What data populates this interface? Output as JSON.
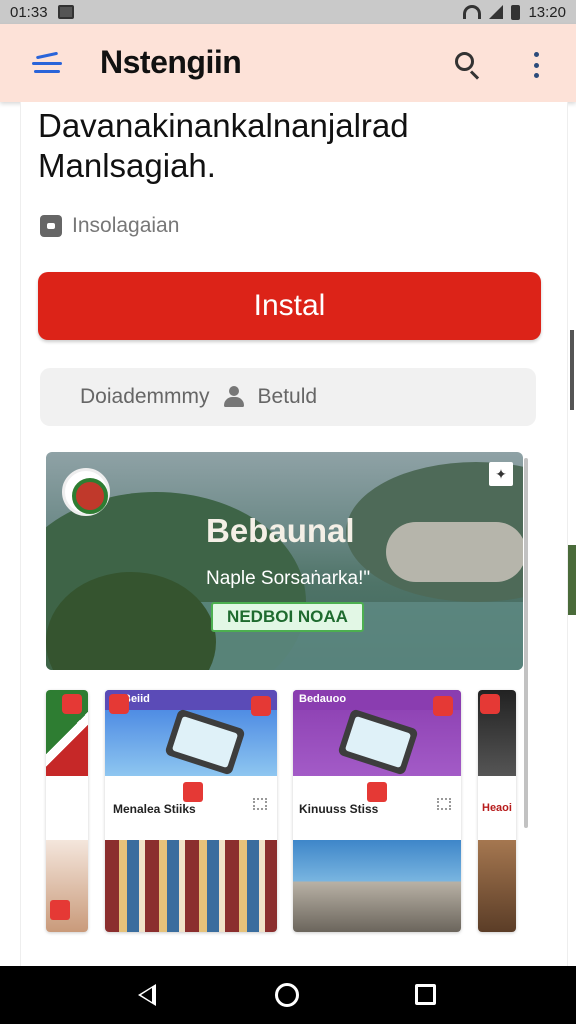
{
  "status_bar": {
    "time_left": "01:33",
    "time_right": "13:20"
  },
  "app_bar": {
    "title": "Nstengiin"
  },
  "headline": "Davanakinankalnanjalrad Manlsagiah.",
  "install_info": "Insolagaian",
  "install_button": "Instal",
  "secondary": {
    "left_label": "Doiademmmy",
    "right_label": "Betuld"
  },
  "banner": {
    "title": "Bebaunal",
    "subtitle": "Naple Sorsaṅarka!\"",
    "cta": "NEDBOI NOAA"
  },
  "cards": [
    {
      "strip_label": "",
      "label": "",
      "strip_color": "#d32f2f"
    },
    {
      "strip_label": "Beiid",
      "label": "Menalea Stiiks",
      "strip_color": "#5b4bb7"
    },
    {
      "strip_label": "Bedauoo",
      "label": "Kinuuss Stiss",
      "strip_color": "#8a3db0"
    },
    {
      "strip_label": "",
      "label": "Heaoi",
      "strip_color": "#b71c1c"
    }
  ],
  "colors": {
    "install_button": "#dc2318",
    "app_bar": "#fde2d8",
    "accent_menu": "#2a64d9"
  }
}
